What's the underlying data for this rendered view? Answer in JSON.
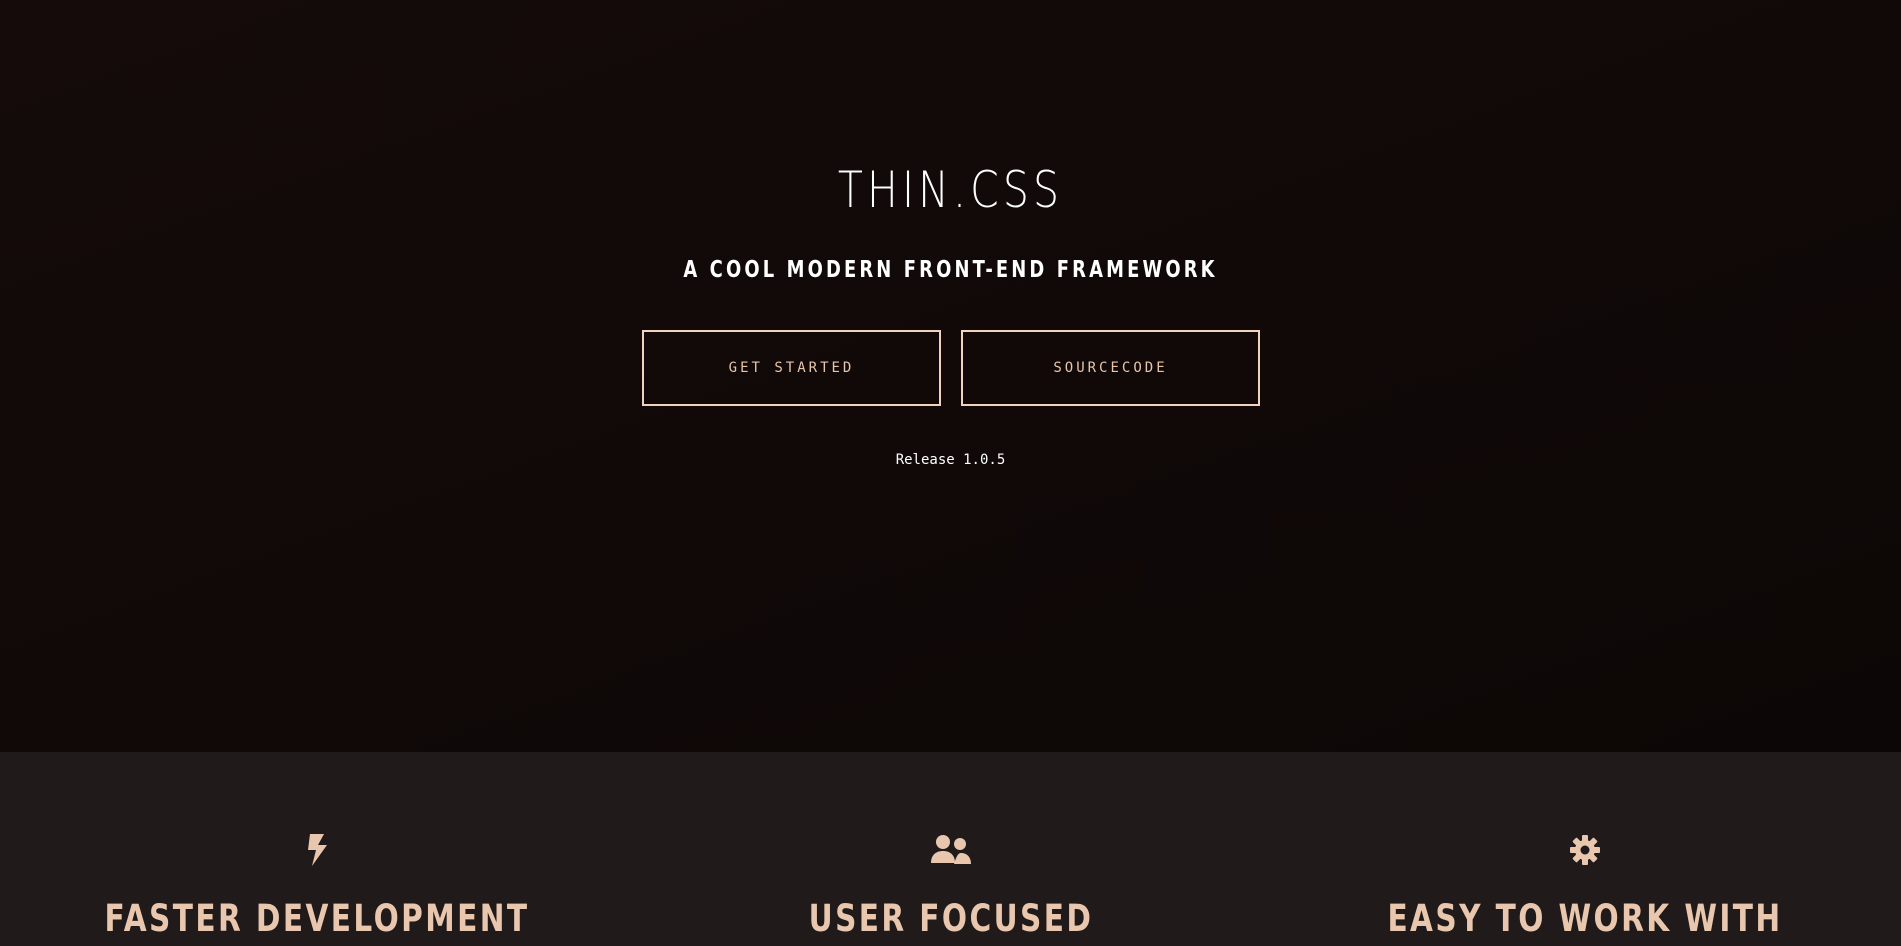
{
  "hero": {
    "title": "THIN.CSS",
    "subtitle": "A COOL MODERN FRONT-END FRAMEWORK",
    "buttons": {
      "get_started_label": "GET STARTED",
      "sourcecode_label": "SOURCECODE"
    },
    "release": "Release 1.0.5"
  },
  "features": [
    {
      "icon": "bolt-icon",
      "title": "FASTER DEVELOPMENT"
    },
    {
      "icon": "users-icon",
      "title": "USER FOCUSED"
    },
    {
      "icon": "gear-icon",
      "title": "EASY TO WORK WITH"
    }
  ],
  "colors": {
    "hero_background": "#100908",
    "features_background": "#201b1a",
    "accent": "#e9c7ae",
    "button_border": "#f1d2bd",
    "text_primary": "#ffffff"
  }
}
